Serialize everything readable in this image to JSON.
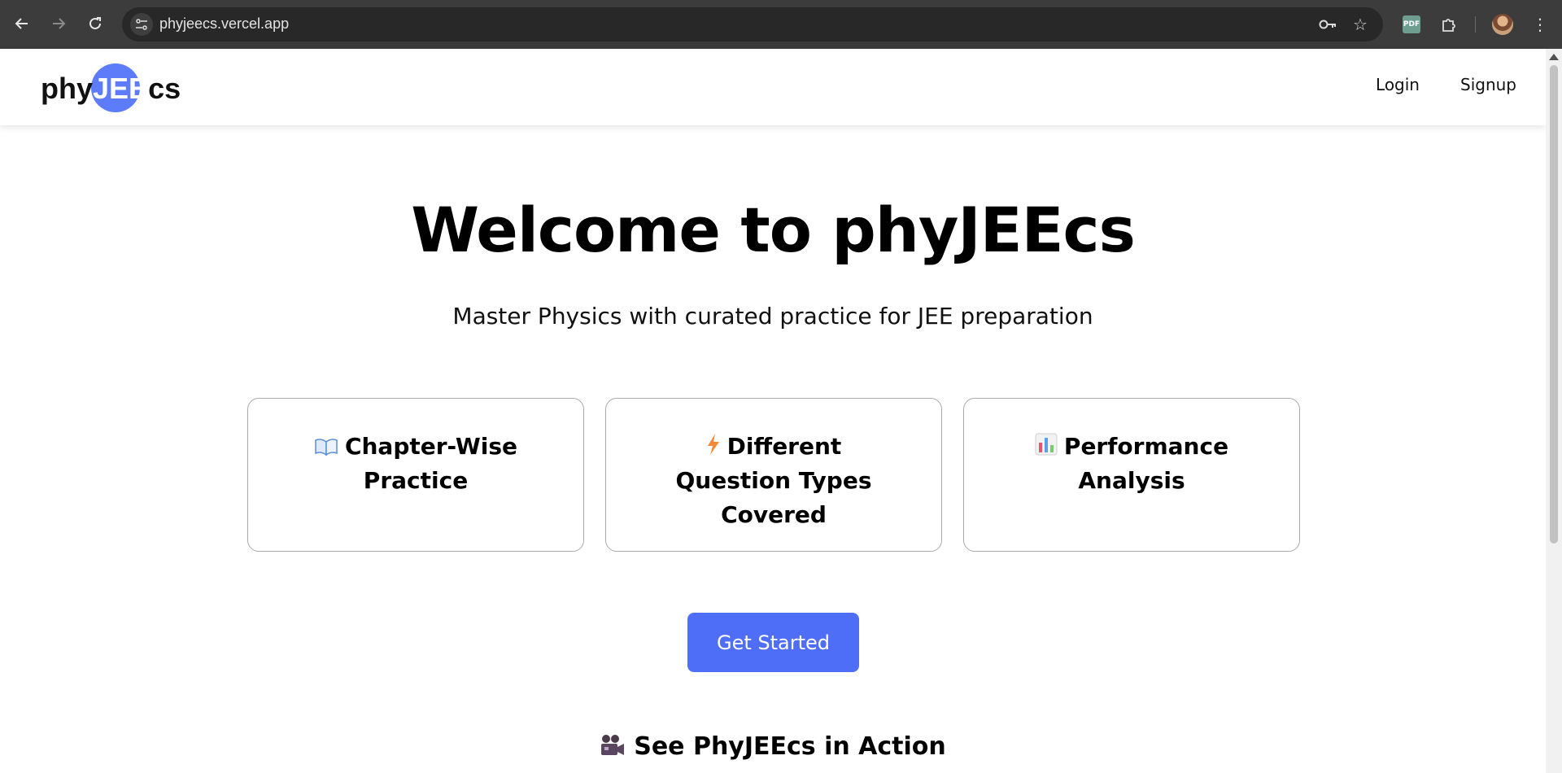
{
  "browser": {
    "url": "phyjeecs.vercel.app",
    "back_icon": "arrow-left-icon",
    "forward_icon": "arrow-right-icon",
    "reload_icon": "reload-icon",
    "site_info_icon": "tune-icon",
    "password_icon": "key-icon",
    "bookmark_icon": "star-icon",
    "pdf_extension_label": "PDF",
    "extensions_icon": "puzzle-icon",
    "menu_icon": "kebab-menu-icon"
  },
  "site": {
    "logo": {
      "left": "phy",
      "middle": "JEE",
      "right": "cs",
      "accent_color": "#5c7cfa"
    },
    "nav": {
      "login_label": "Login",
      "signup_label": "Signup"
    },
    "hero": {
      "title": "Welcome to phyJEEcs",
      "subtitle": "Master Physics with curated practice for JEE preparation"
    },
    "features": [
      {
        "icon": "open-book-icon",
        "title": "Chapter-Wise Practice"
      },
      {
        "icon": "lightning-icon",
        "title": "Different Question Types Covered"
      },
      {
        "icon": "bar-chart-icon",
        "title": "Performance Analysis"
      }
    ],
    "cta": {
      "label": "Get Started",
      "color": "#4f6ef7"
    },
    "demo_section": {
      "icon": "movie-camera-icon",
      "title": "See PhyJEEcs in Action"
    }
  }
}
